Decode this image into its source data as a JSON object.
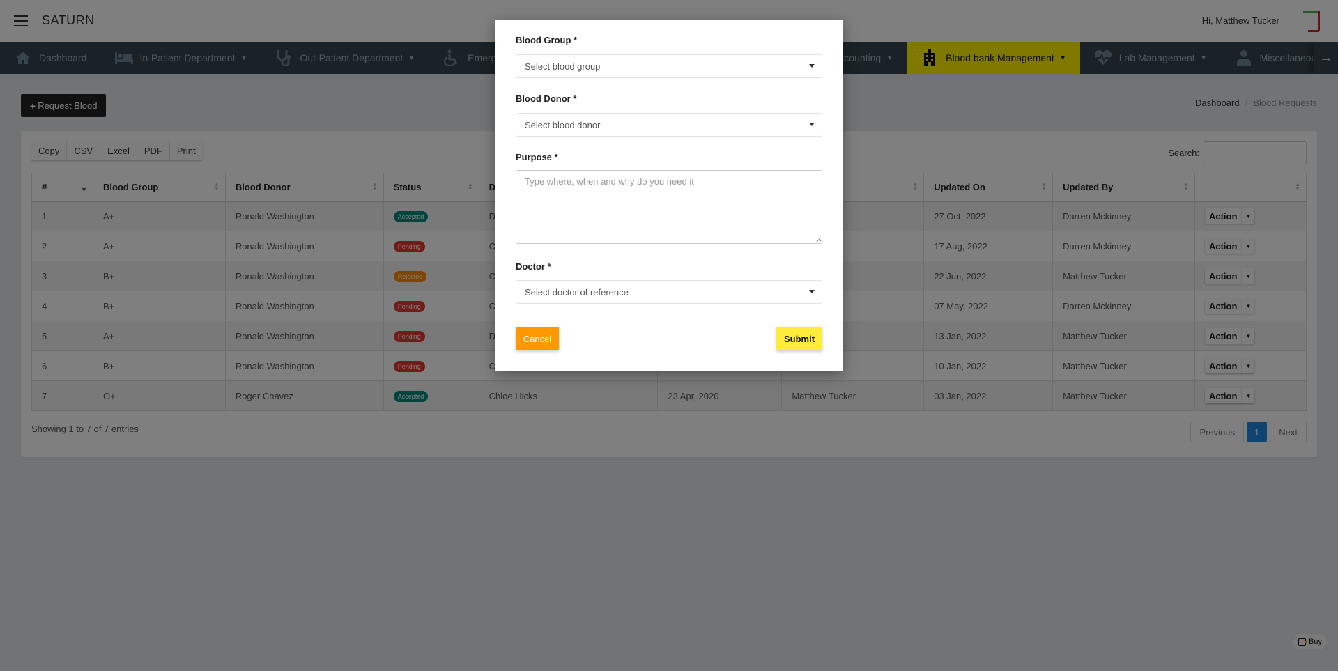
{
  "header": {
    "brand": "SATURN",
    "greeting": "Hi, Matthew Tucker"
  },
  "nav": {
    "items": [
      {
        "label": "Dashboard",
        "icon": "home-icon",
        "has_dropdown": false,
        "active": false
      },
      {
        "label": "In-Patient Department",
        "icon": "bed-icon",
        "has_dropdown": true,
        "active": false
      },
      {
        "label": "Out-Patient Department",
        "icon": "stethoscope-icon",
        "has_dropdown": true,
        "active": false
      },
      {
        "label": "Emergency",
        "icon": "wheelchair-icon",
        "has_dropdown": true,
        "active": false
      },
      {
        "label": "Accounting",
        "icon": "numbered-list-icon",
        "has_dropdown": true,
        "active": false
      },
      {
        "label": "Blood bank Management",
        "icon": "hospital-building-icon",
        "has_dropdown": true,
        "active": true
      },
      {
        "label": "Lab Management",
        "icon": "heartbeat-icon",
        "has_dropdown": true,
        "active": false
      },
      {
        "label": "Miscellaneous",
        "icon": "doctor-icon",
        "has_dropdown": true,
        "active": false
      }
    ],
    "next_icon": "arrow-right-icon"
  },
  "page": {
    "request_button": "Request Blood",
    "breadcrumb": {
      "home": "Dashboard",
      "current": "Blood Requests"
    }
  },
  "table_tools": {
    "export_buttons": [
      "Copy",
      "CSV",
      "Excel",
      "PDF",
      "Print"
    ],
    "search_label": "Search:",
    "search_value": ""
  },
  "table": {
    "columns": [
      "#",
      "Blood Group",
      "Blood Donor",
      "Status",
      "D",
      "",
      "",
      "Updated On",
      "Updated By",
      ""
    ],
    "rows": [
      {
        "num": "1",
        "group": "A+",
        "donor": "Ronald Washington",
        "status": "Accepted",
        "status_class": "accepted",
        "c5": "D",
        "c6": "",
        "c7": "ney",
        "updated_on": "27 Oct, 2022",
        "updated_by": "Darren Mckinney",
        "action": "Action"
      },
      {
        "num": "2",
        "group": "A+",
        "donor": "Ronald Washington",
        "status": "Pending",
        "status_class": "pending",
        "c5": "C",
        "c6": "",
        "c7": "ney",
        "updated_on": "17 Aug, 2022",
        "updated_by": "Darren Mckinney",
        "action": "Action"
      },
      {
        "num": "3",
        "group": "B+",
        "donor": "Ronald Washington",
        "status": "Rejected",
        "status_class": "rejected",
        "c5": "C",
        "c6": "",
        "c7": "ker",
        "updated_on": "22 Jun, 2022",
        "updated_by": "Matthew Tucker",
        "action": "Action"
      },
      {
        "num": "4",
        "group": "B+",
        "donor": "Ronald Washington",
        "status": "Pending",
        "status_class": "pending",
        "c5": "C",
        "c6": "",
        "c7": "ney",
        "updated_on": "07 May, 2022",
        "updated_by": "Darren Mckinney",
        "action": "Action"
      },
      {
        "num": "5",
        "group": "A+",
        "donor": "Ronald Washington",
        "status": "Pending",
        "status_class": "pending",
        "c5": "D",
        "c6": "",
        "c7": "ker",
        "updated_on": "13 Jan, 2022",
        "updated_by": "Matthew Tucker",
        "action": "Action"
      },
      {
        "num": "6",
        "group": "B+",
        "donor": "Ronald Washington",
        "status": "Pending",
        "status_class": "pending",
        "c5": "C",
        "c6": "",
        "c7": "ker",
        "updated_on": "10 Jan, 2022",
        "updated_by": "Matthew Tucker",
        "action": "Action"
      },
      {
        "num": "7",
        "group": "O+",
        "donor": "Roger Chavez",
        "status": "Accepted",
        "status_class": "accepted",
        "c5": "Chloe Hicks",
        "c6": "23 Apr, 2020",
        "c7": "Matthew Tucker",
        "updated_on": "03 Jan, 2022",
        "updated_by": "Matthew Tucker",
        "action": "Action"
      }
    ],
    "info": "Showing 1 to 7 of 7 entries",
    "pagination": {
      "previous": "Previous",
      "current": "1",
      "next": "Next"
    }
  },
  "buy_badge": "Buy",
  "modal": {
    "fields": {
      "blood_group": {
        "label": "Blood Group *",
        "placeholder": "Select blood group"
      },
      "blood_donor": {
        "label": "Blood Donor *",
        "placeholder": "Select blood donor"
      },
      "purpose": {
        "label": "Purpose *",
        "placeholder": "Type where, when and why do you need it",
        "value": ""
      },
      "doctor": {
        "label": "Doctor *",
        "placeholder": "Select doctor of reference"
      }
    },
    "cancel_label": "Cancel",
    "submit_label": "Submit"
  },
  "colors": {
    "nav_bg": "#35444e",
    "nav_active": "#fff200",
    "accepted": "#00897b",
    "pending": "#e53935",
    "rejected": "#fb8c00",
    "cancel": "#ff9800",
    "submit": "#ffeb3b",
    "pager_active": "#1e88e5"
  }
}
